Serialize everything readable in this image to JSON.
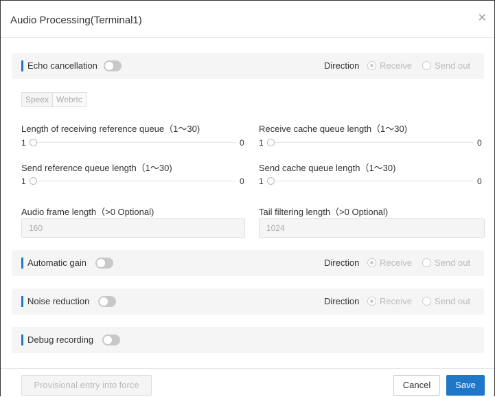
{
  "dialog": {
    "title": "Audio Processing(Terminal1)",
    "close_label": "×"
  },
  "echo": {
    "label": "Echo cancellation",
    "enabled": false,
    "direction_label": "Direction",
    "receive_label": "Receive",
    "send_label": "Send out",
    "selected": "Receive"
  },
  "engine_tabs": [
    "Speex",
    "Webrtc"
  ],
  "queues": {
    "recv_ref": {
      "label": "Length of receiving reference queue（1～30)",
      "min": "1",
      "max": "0"
    },
    "recv_cache": {
      "label": "Receive cache queue length（1～30)",
      "min": "1",
      "max": "0"
    },
    "send_ref": {
      "label": "Send reference queue length（1～30)",
      "min": "1",
      "max": "0"
    },
    "send_cache": {
      "label": "Send cache queue length（1～30)",
      "min": "1",
      "max": "0"
    }
  },
  "frame": {
    "label": "Audio frame length（>0 Optional)",
    "value": "160"
  },
  "tail": {
    "label": "Tail filtering length（>0 Optional)",
    "value": "1024"
  },
  "gain": {
    "label": "Automatic gain",
    "enabled": false,
    "direction_label": "Direction",
    "receive_label": "Receive",
    "send_label": "Send out",
    "selected": "Receive"
  },
  "noise": {
    "label": "Noise reduction",
    "enabled": false,
    "direction_label": "Direction",
    "receive_label": "Receive",
    "send_label": "Send out",
    "selected": "Receive"
  },
  "debug": {
    "label": "Debug recording",
    "enabled": false
  },
  "footer": {
    "provisional_label": "Provisional entry into force",
    "cancel_label": "Cancel",
    "save_label": "Save"
  },
  "colors": {
    "accent": "#1e77c8",
    "section_bg": "#f5f5f5",
    "toggle_off": "#c8c8c8"
  }
}
